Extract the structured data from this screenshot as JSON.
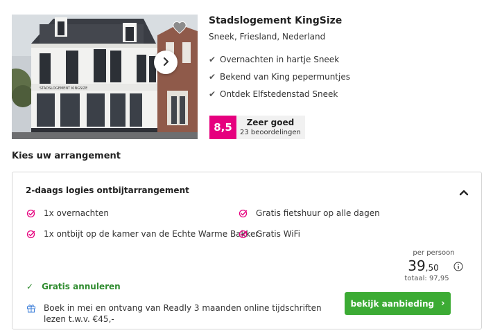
{
  "hotel": {
    "name": "Stadslogement KingSize",
    "location": "Sneek, Friesland, Nederland",
    "usps": [
      "Overnachten in hartje Sneek",
      "Bekend van King pepermuntjes",
      "Ontdek Elfstedenstad Sneek"
    ],
    "rating": {
      "score": "8,5",
      "label": "Zeer goed",
      "count": "23 beoordelingen"
    },
    "photo": {
      "alt": "Stadslogement KingSize gebouw"
    },
    "photo_sign_text": "STADSLOGEMENT  KINGSIZE"
  },
  "arrangements": {
    "section_title": "Kies uw arrangement",
    "card": {
      "title": "2-daags logies ontbijtarrangement",
      "inclusions": [
        "1x overnachten",
        "Gratis fietshuur op alle dagen",
        "1x ontbijt op de kamer van de Echte Warme Bakker",
        "Gratis WiFi"
      ],
      "price": {
        "per_label": "per persoon",
        "main": "39",
        "cents": ",50",
        "total": "totaal: 97,95"
      },
      "cancel": "Gratis annuleren",
      "promo": "Boek in mei en ontvang van Readly 3 maanden online tijdschriften lezen t.w.v. €45,-",
      "cta_label": "bekijk aanbieding",
      "cta_arrow": "›"
    }
  },
  "icons": {
    "usp_check": "✔",
    "cancel_check": "✓",
    "heart": "heart-icon",
    "chevron_right": "chevron-right-icon",
    "chevron_up": "chevron-up-icon",
    "info": "info-icon",
    "gift": "gift-icon",
    "inclusion": "check-circle-icon"
  },
  "colors": {
    "brand_pink": "#e6007e",
    "cta_green": "#3cab34",
    "cancel_green": "#2e8b2e",
    "gift_blue": "#3b7dd8"
  }
}
